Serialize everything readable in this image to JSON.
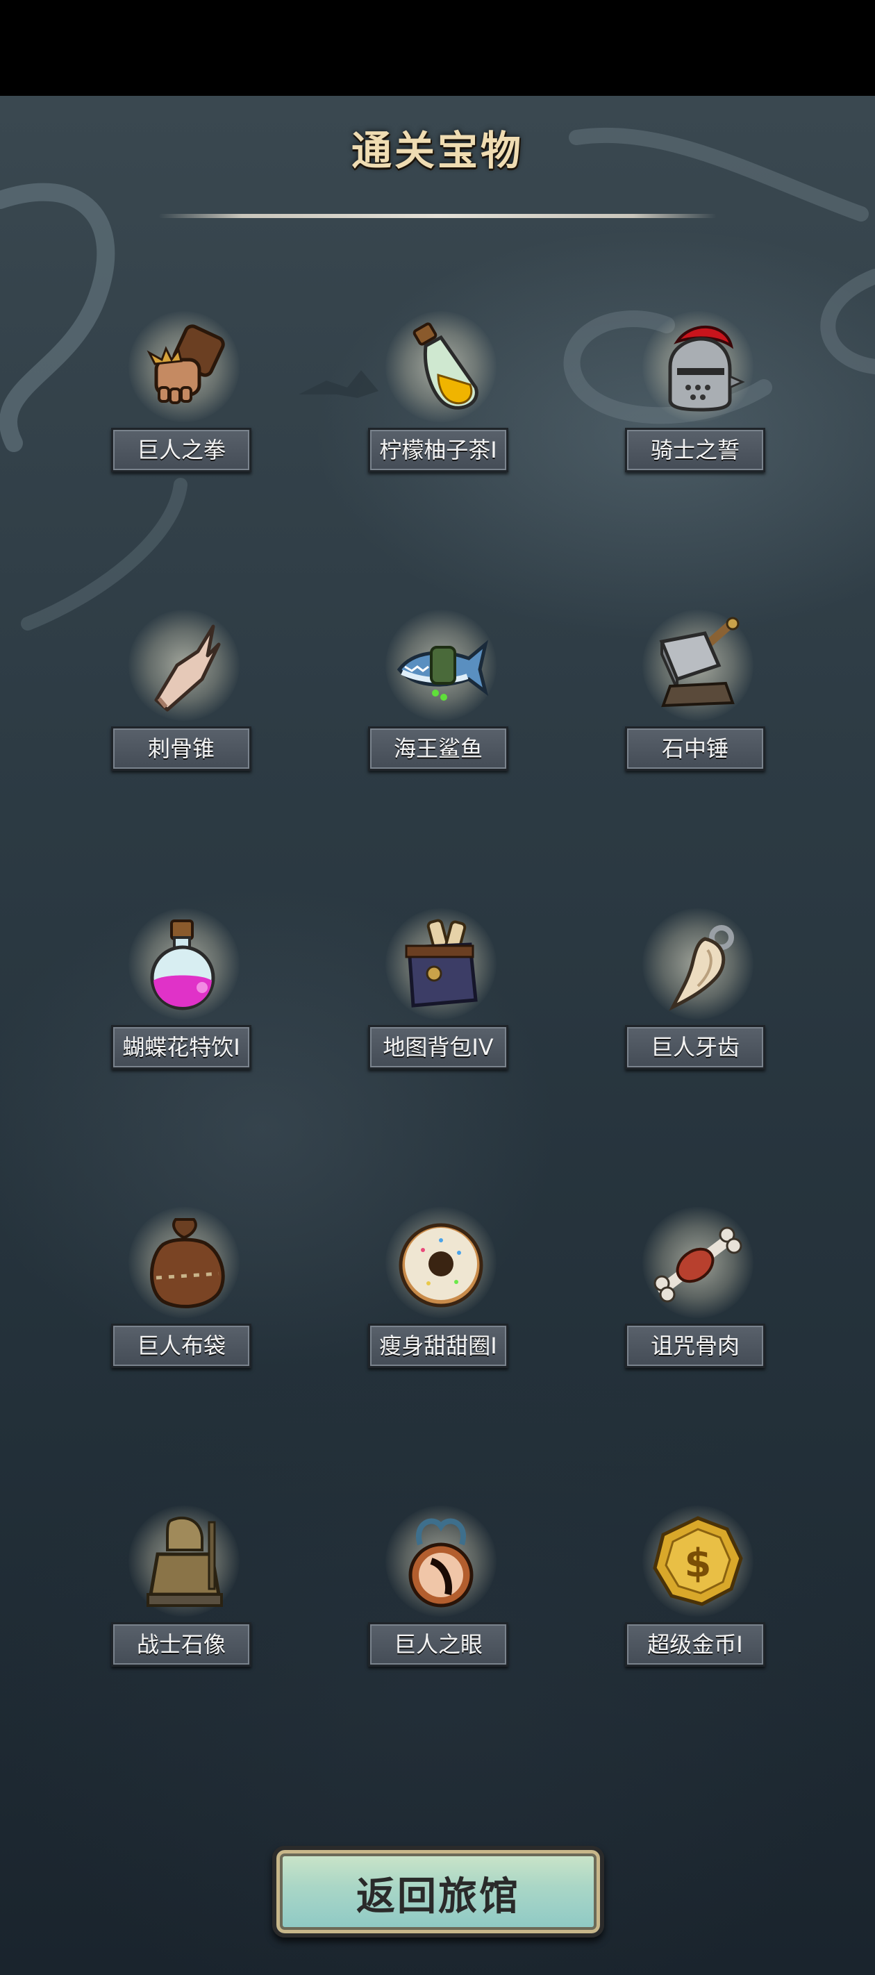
{
  "header": {
    "title": "通关宝物"
  },
  "items": [
    {
      "name": "巨人之拳",
      "icon": "gauntlet-fist-icon"
    },
    {
      "name": "柠檬柚子茶I",
      "icon": "potion-bottle-yellow-icon"
    },
    {
      "name": "骑士之誓",
      "icon": "knight-helmet-icon"
    },
    {
      "name": "刺骨锥",
      "icon": "bone-spike-icon"
    },
    {
      "name": "海王鲨鱼",
      "icon": "shark-fish-icon"
    },
    {
      "name": "石中锤",
      "icon": "stone-hammer-icon"
    },
    {
      "name": "蝴蝶花特饮I",
      "icon": "potion-flask-pink-icon"
    },
    {
      "name": "地图背包IV",
      "icon": "map-backpack-icon"
    },
    {
      "name": "巨人牙齿",
      "icon": "giant-tooth-icon"
    },
    {
      "name": "巨人布袋",
      "icon": "cloth-sack-icon"
    },
    {
      "name": "瘦身甜甜圈I",
      "icon": "donut-icon"
    },
    {
      "name": "诅咒骨肉",
      "icon": "meat-bone-icon"
    },
    {
      "name": "战士石像",
      "icon": "warrior-statue-icon"
    },
    {
      "name": "巨人之眼",
      "icon": "eye-amulet-icon"
    },
    {
      "name": "超级金币I",
      "icon": "gold-coin-icon"
    }
  ],
  "footer": {
    "back_label": "返回旅馆"
  },
  "colors": {
    "title": "#efdcb2",
    "label_bg": "#4e5660",
    "button_bg": "#a9d6c6"
  }
}
